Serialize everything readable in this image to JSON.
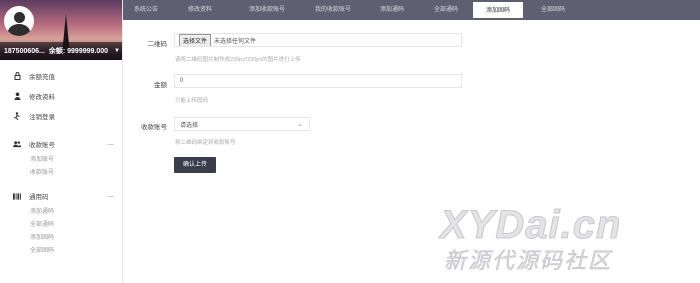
{
  "sidebar": {
    "user_info": "187500606...",
    "balance": "余额: 9999999.000",
    "items": [
      {
        "label": "余额充值",
        "icon": "lock-icon"
      },
      {
        "label": "修改资料",
        "icon": "user-icon"
      },
      {
        "label": "注销登录",
        "icon": "logout-icon"
      }
    ],
    "groups": [
      {
        "label": "收款账号",
        "icon": "users-icon",
        "children": [
          "添加账号",
          "收款账号"
        ]
      },
      {
        "label": "通用码",
        "icon": "qrcode-icon",
        "children": [
          "添加通码",
          "全部通码",
          "添加固码",
          "全部固码"
        ]
      }
    ]
  },
  "tabs": [
    {
      "label": "系统公告",
      "active": false
    },
    {
      "label": "修改资料",
      "active": false
    },
    {
      "label": "添加收款账号",
      "active": false
    },
    {
      "label": "我的收款账号",
      "active": false
    },
    {
      "label": "添加通码",
      "active": false
    },
    {
      "label": "全部通码",
      "active": false
    },
    {
      "label": "添加固码",
      "active": true
    },
    {
      "label": "全部固码",
      "active": false
    }
  ],
  "form": {
    "qrcode_label": "二维码",
    "file_button": "选择文件",
    "file_status": "未选择任何文件",
    "qrcode_hint": "请将二维码图片制作成230px*230px的图片进行上传",
    "amount_label": "金额",
    "amount_value": "0",
    "amount_hint": "只能上传固码",
    "account_label": "收款账号",
    "account_value": "请选择",
    "account_hint": "将二维码绑定到收款账号",
    "submit_label": "确认上传"
  },
  "watermark": {
    "line1": "XYDai.cn",
    "line2": "新源代源码社区"
  },
  "colors": {
    "topbar": "#5f5f72",
    "submit": "#393d49"
  }
}
